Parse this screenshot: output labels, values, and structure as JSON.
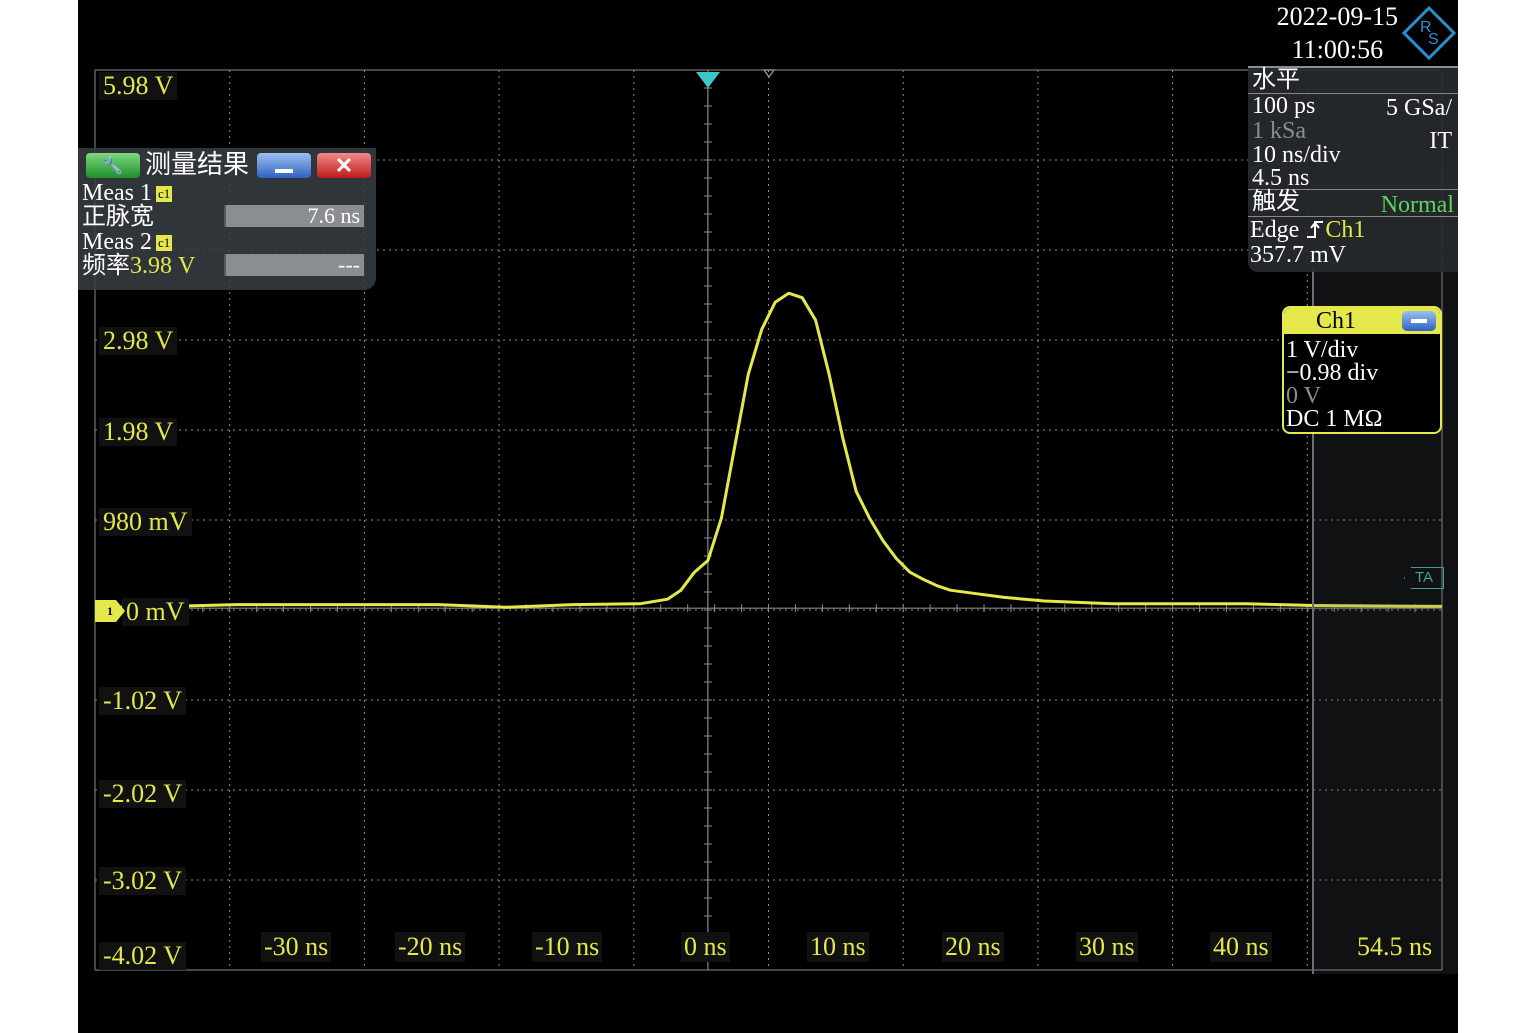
{
  "header": {
    "date": "2022-09-15",
    "time": "11:00:56",
    "logo_icon": "rs-diamond-logo"
  },
  "y_axis_labels": [
    "5.98 V",
    "2.98 V",
    "1.98 V",
    "980 mV",
    "0 mV",
    "-1.02 V",
    "-2.02 V",
    "-3.02 V",
    "-4.02 V"
  ],
  "x_axis_labels": [
    "-30 ns",
    "-20 ns",
    "-10 ns",
    "0 ns",
    "10 ns",
    "20 ns",
    "30 ns",
    "40 ns",
    "54.5 ns"
  ],
  "measurement_window": {
    "title": "测量结果",
    "close_symbol": "✕",
    "tool_icon": "wrench-icon",
    "meas1": {
      "label": "Meas 1",
      "channel_tag": "c1",
      "param": "正脉宽",
      "value": "7.6 ns"
    },
    "meas2": {
      "label": "Meas 2",
      "channel_tag": "c1",
      "param": "频率",
      "param_level": "3.98 V",
      "value": "---"
    }
  },
  "horizontal_panel": {
    "title": "水平",
    "resolution": "100 ps",
    "sample_rate": "5 GSa/",
    "record_length": "1 kSa",
    "mode": "IT",
    "time_scale": "10 ns/div",
    "position": "4.5 ns"
  },
  "trigger_panel": {
    "title": "触发",
    "mode": "Normal",
    "type": "Edge",
    "source": "Ch1",
    "level": "357.7 mV"
  },
  "channel_panel": {
    "name": "Ch1",
    "scale": "1 V/div",
    "offset_div": "−0.98 div",
    "offset_v": "0 V",
    "coupling": "DC 1 MΩ"
  },
  "markers": {
    "reference": "TA",
    "ground": "1"
  },
  "colors": {
    "trace": "#e5e84a",
    "grid": "#8a8a8a",
    "trigger_marker": "#3ec6c6",
    "background": "#000000"
  },
  "chart_data": {
    "type": "line",
    "x_unit": "ns",
    "y_unit": "V",
    "xlim": [
      -45.5,
      54.5
    ],
    "ylim": [
      -4.02,
      5.98
    ],
    "grid": true,
    "series": [
      {
        "x": [
          -45.5,
          -40,
          -35,
          -30,
          -25,
          -20,
          -15,
          -10,
          -5,
          -3,
          -2,
          -1,
          0,
          1,
          2,
          3,
          4,
          5,
          6,
          7,
          8,
          9,
          10,
          11,
          12,
          13,
          14,
          15,
          16,
          17,
          18,
          20,
          22,
          25,
          30,
          35,
          40,
          45,
          54.5
        ],
        "values": [
          0.0,
          0.02,
          0.04,
          0.04,
          0.04,
          0.04,
          0.01,
          0.04,
          0.05,
          0.1,
          0.2,
          0.4,
          0.53,
          1.0,
          1.8,
          2.6,
          3.1,
          3.4,
          3.5,
          3.45,
          3.2,
          2.6,
          1.9,
          1.3,
          1.0,
          0.75,
          0.55,
          0.4,
          0.32,
          0.25,
          0.2,
          0.16,
          0.12,
          0.08,
          0.05,
          0.05,
          0.05,
          0.03,
          0.02
        ]
      }
    ]
  }
}
